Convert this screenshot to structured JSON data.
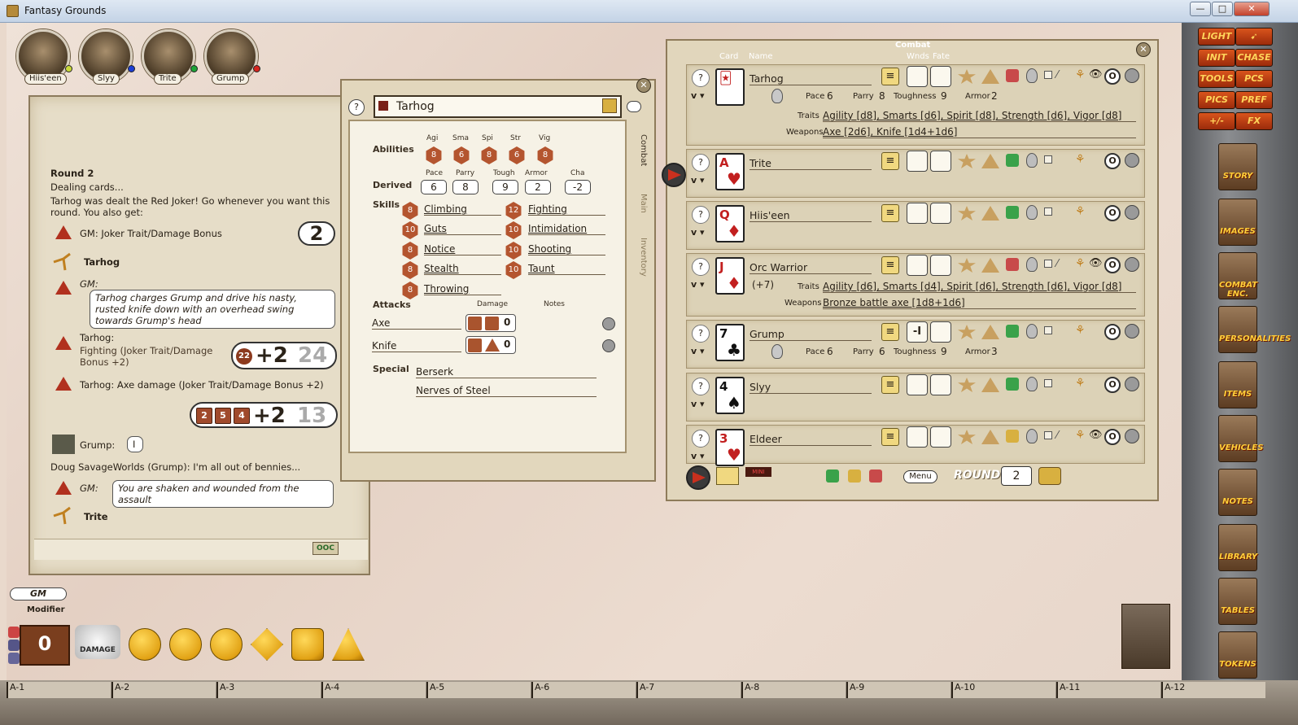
{
  "window": {
    "title": "Fantasy Grounds",
    "min": "—",
    "max": "□",
    "close": "✕"
  },
  "party": [
    {
      "name": "Hiis'een",
      "dot": "#c8d83a"
    },
    {
      "name": "Slyy",
      "dot": "#1b3ed6"
    },
    {
      "name": "Trite",
      "dot": "#1ea438"
    },
    {
      "name": "Grump",
      "dot": "#d6251e"
    }
  ],
  "chat": {
    "round": "Round 2",
    "dealing": "Dealing cards...",
    "joker": "Tarhog was dealt the Red Joker! Go whenever you want this round. You also get:",
    "gm_joker": "GM:  Joker Trait/Damage Bonus",
    "joker_value": "2",
    "tarhog1": "Tarhog",
    "gm_label": "GM:",
    "gm_story": "Tarhog charges Grump and drive his nasty, rusted knife down with an overhead swing towards Grump's head",
    "tarhog_roll_label": "Tarhog:",
    "tarhog_roll_desc": "Fighting (Joker Trait/Damage Bonus +2)",
    "roll1_die": "22",
    "roll1_mod": "+2",
    "roll1_total": "24",
    "axe_line": "Tarhog:   Axe damage (Joker Trait/Damage Bonus +2)",
    "roll2_dice": [
      "2",
      "5",
      "4"
    ],
    "roll2_mod": "+2",
    "roll2_total": "13",
    "grump": "Grump:",
    "grump_bubble": "I",
    "doug": "Doug SavageWorlds (Grump):  I'm all out of bennies...",
    "gm2_label": "GM:",
    "gm_shaken": "You are shaken and wounded from the assault",
    "trite": "Trite",
    "ooc": "OOC"
  },
  "sheet": {
    "name": "Tarhog",
    "abilities_label": "Abilities",
    "abilities": [
      {
        "k": "Agi",
        "v": "8"
      },
      {
        "k": "Sma",
        "v": "6"
      },
      {
        "k": "Spi",
        "v": "8"
      },
      {
        "k": "Str",
        "v": "6"
      },
      {
        "k": "Vig",
        "v": "8"
      }
    ],
    "derived_label": "Derived",
    "derived": [
      {
        "k": "Pace",
        "v": "6"
      },
      {
        "k": "Parry",
        "v": "8"
      },
      {
        "k": "Tough",
        "v": "9"
      },
      {
        "k": "Armor",
        "v": "2"
      },
      {
        "k": "Cha",
        "v": "-2"
      }
    ],
    "skills_label": "Skills",
    "skills_left": [
      {
        "d": "8",
        "n": "Climbing"
      },
      {
        "d": "10",
        "n": "Guts"
      },
      {
        "d": "8",
        "n": "Notice"
      },
      {
        "d": "8",
        "n": "Stealth"
      },
      {
        "d": "8",
        "n": "Throwing"
      }
    ],
    "skills_right": [
      {
        "d": "12",
        "n": "Fighting"
      },
      {
        "d": "10",
        "n": "Intimidation"
      },
      {
        "d": "10",
        "n": "Shooting"
      },
      {
        "d": "10",
        "n": "Taunt"
      }
    ],
    "attacks_label": "Attacks",
    "damage_label": "Damage",
    "notes_label": "Notes",
    "attacks": [
      {
        "n": "Axe",
        "v": "0"
      },
      {
        "n": "Knife",
        "v": "0"
      }
    ],
    "special_label": "Special",
    "special": [
      "Berserk",
      "Nerves of Steel"
    ],
    "tabs": [
      "Combat",
      "Main",
      "Inventory"
    ]
  },
  "combat": {
    "header": {
      "combat": "Combat",
      "card": "Card",
      "name": "Name",
      "wnds": "Wnds",
      "fate": "Fate"
    },
    "rows": [
      {
        "name": "Tarhog",
        "rank": "🃏",
        "suit": "",
        "red": true,
        "w1": "",
        "w2": "",
        "pace": "6",
        "parry": "8",
        "tough": "9",
        "armor": "2",
        "traits": "Agility [d8], Smarts [d6], Spirit [d8], Strength [d6], Vigor [d8]",
        "weapons": "Axe [2d6], Knife [1d4+1d6]"
      },
      {
        "name": "Trite",
        "rank": "A",
        "suit": "♥",
        "red": true,
        "w1": "",
        "w2": ""
      },
      {
        "name": "Hiis'een",
        "rank": "Q",
        "suit": "♦",
        "red": true,
        "w1": "",
        "w2": ""
      },
      {
        "name": "Orc Warrior",
        "rank": "J",
        "suit": "♦",
        "red": true,
        "w1": "",
        "w2": "",
        "mod": "(+7)",
        "traits": "Agility [d6], Smarts [d4], Spirit [d6], Strength [d6], Vigor [d8]",
        "weapons": "Bronze battle axe [1d8+1d6]"
      },
      {
        "name": "Grump",
        "rank": "7",
        "suit": "♣",
        "red": false,
        "w1": "-I",
        "w2": "",
        "pace": "6",
        "parry": "6",
        "tough": "9",
        "armor": "3"
      },
      {
        "name": "Slyy",
        "rank": "4",
        "suit": "♠",
        "red": false,
        "w1": "",
        "w2": ""
      },
      {
        "name": "Eldeer",
        "rank": "3",
        "suit": "♥",
        "red": true,
        "w1": "",
        "w2": ""
      }
    ],
    "labels": {
      "pace": "Pace",
      "parry": "Parry",
      "toughness": "Toughness",
      "armor": "Armor",
      "traits": "Traits",
      "weapons": "Weapons"
    },
    "menu": "Menu",
    "round_label": "ROUND",
    "round": "2",
    "mini": "MINI"
  },
  "sidebar": {
    "buttons": [
      "LIGHT",
      "➹",
      "INIT",
      "CHASE",
      "TOOLS",
      "PCS",
      "PICS",
      "PREF",
      "+/-",
      "FX"
    ],
    "books": [
      "STORY",
      "IMAGES",
      "COMBAT ENC.",
      "PERSONALITIES",
      "ITEMS",
      "VEHICLES",
      "NOTES",
      "LIBRARY",
      "TABLES",
      "TOKENS"
    ]
  },
  "modifier": {
    "gm": "GM",
    "label": "Modifier",
    "value": "0",
    "damage": "DAMAGE"
  },
  "dice": [
    "20",
    "12",
    "10",
    "8",
    "6",
    "4"
  ],
  "grid": [
    "A-1",
    "A-2",
    "A-3",
    "A-4",
    "A-5",
    "A-6",
    "A-7",
    "A-8",
    "A-9",
    "A-10",
    "A-11",
    "A-12"
  ]
}
